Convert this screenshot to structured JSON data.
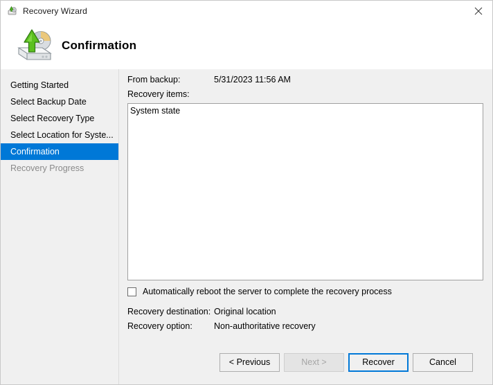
{
  "window": {
    "title": "Recovery Wizard",
    "title_icon": "recovery-disk-icon",
    "close_icon": "close-icon"
  },
  "header": {
    "title": "Confirmation",
    "icon": "recovery-disk-restore-icon"
  },
  "sidebar": {
    "items": [
      {
        "label": "Getting Started",
        "state": "normal"
      },
      {
        "label": "Select Backup Date",
        "state": "normal"
      },
      {
        "label": "Select Recovery Type",
        "state": "normal"
      },
      {
        "label": "Select Location for Syste...",
        "state": "normal"
      },
      {
        "label": "Confirmation",
        "state": "selected"
      },
      {
        "label": "Recovery Progress",
        "state": "disabled"
      }
    ]
  },
  "content": {
    "from_backup_label": "From backup:",
    "from_backup_value": "5/31/2023 11:56 AM",
    "recovery_items_label": "Recovery items:",
    "recovery_items": [
      "System state"
    ],
    "reboot_checkbox": {
      "label": "Automatically reboot the server to complete the recovery process",
      "checked": false
    },
    "recovery_destination_label": "Recovery destination:",
    "recovery_destination_value": "Original location",
    "recovery_option_label": "Recovery option:",
    "recovery_option_value": "Non-authoritative recovery"
  },
  "buttons": {
    "previous": "< Previous",
    "next": "Next >",
    "recover": "Recover",
    "cancel": "Cancel"
  },
  "colors": {
    "accent": "#0078d7",
    "body_background": "#f0f0f0",
    "panel_white": "#ffffff",
    "disabled_text": "#a6a6a6"
  }
}
